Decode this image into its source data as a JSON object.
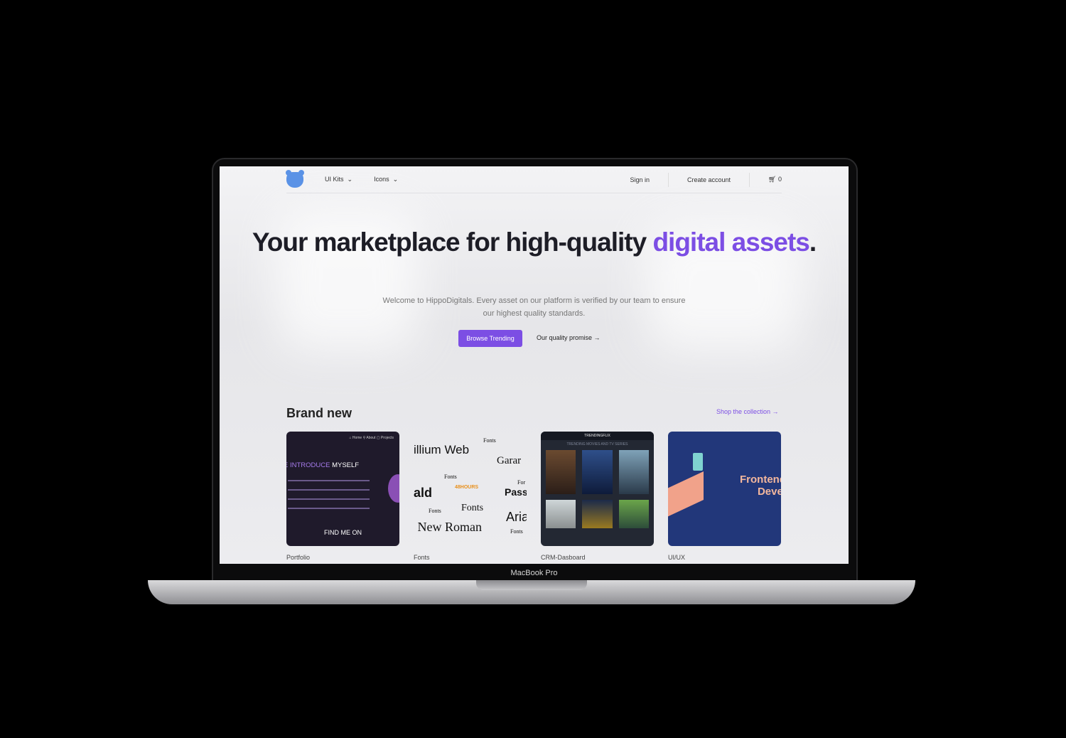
{
  "device_label": "MacBook Pro",
  "nav": {
    "items": [
      "UI Kits",
      "Icons"
    ],
    "sign_in": "Sign in",
    "create_account": "Create account",
    "cart_count": "0"
  },
  "hero": {
    "title_part1": "Your marketplace for high-quality ",
    "title_accent": "digital assets",
    "title_end": ".",
    "subtitle": "Welcome to HippoDigitals. Every asset on our platform is verified by our team to ensure our highest quality standards.",
    "primary_button": "Browse Trending",
    "secondary_link": "Our quality promise →"
  },
  "section": {
    "title": "Brand new",
    "link": "Shop the collection →",
    "products": [
      {
        "name": "Portfolio",
        "preview": {
          "nav": "⌂ Home   ⚲ About   ▢ Projects",
          "headline": "E INTRODUCE",
          "headline2": "MYSELF",
          "footer": "FIND ME ON"
        }
      },
      {
        "name": "Fonts",
        "preview": {
          "words": [
            "illium Web",
            "Fonts",
            "Garar",
            "Fonts",
            "ald",
            "48HOURS",
            "For",
            "Pass",
            "Fonts",
            "Fonts",
            "Aria",
            "; New Roman",
            "Fonts"
          ]
        }
      },
      {
        "name": "CRM-Dasboard",
        "preview": {
          "brand": "TRENDINGFLIX",
          "heading": "TRENDING MOVIES AND TV SERIES"
        }
      },
      {
        "name": "UI/UX",
        "preview": {
          "text": "Frontend Devel"
        }
      }
    ]
  },
  "colors": {
    "accent": "#7c4ee4",
    "logo": "#5a92e6"
  }
}
